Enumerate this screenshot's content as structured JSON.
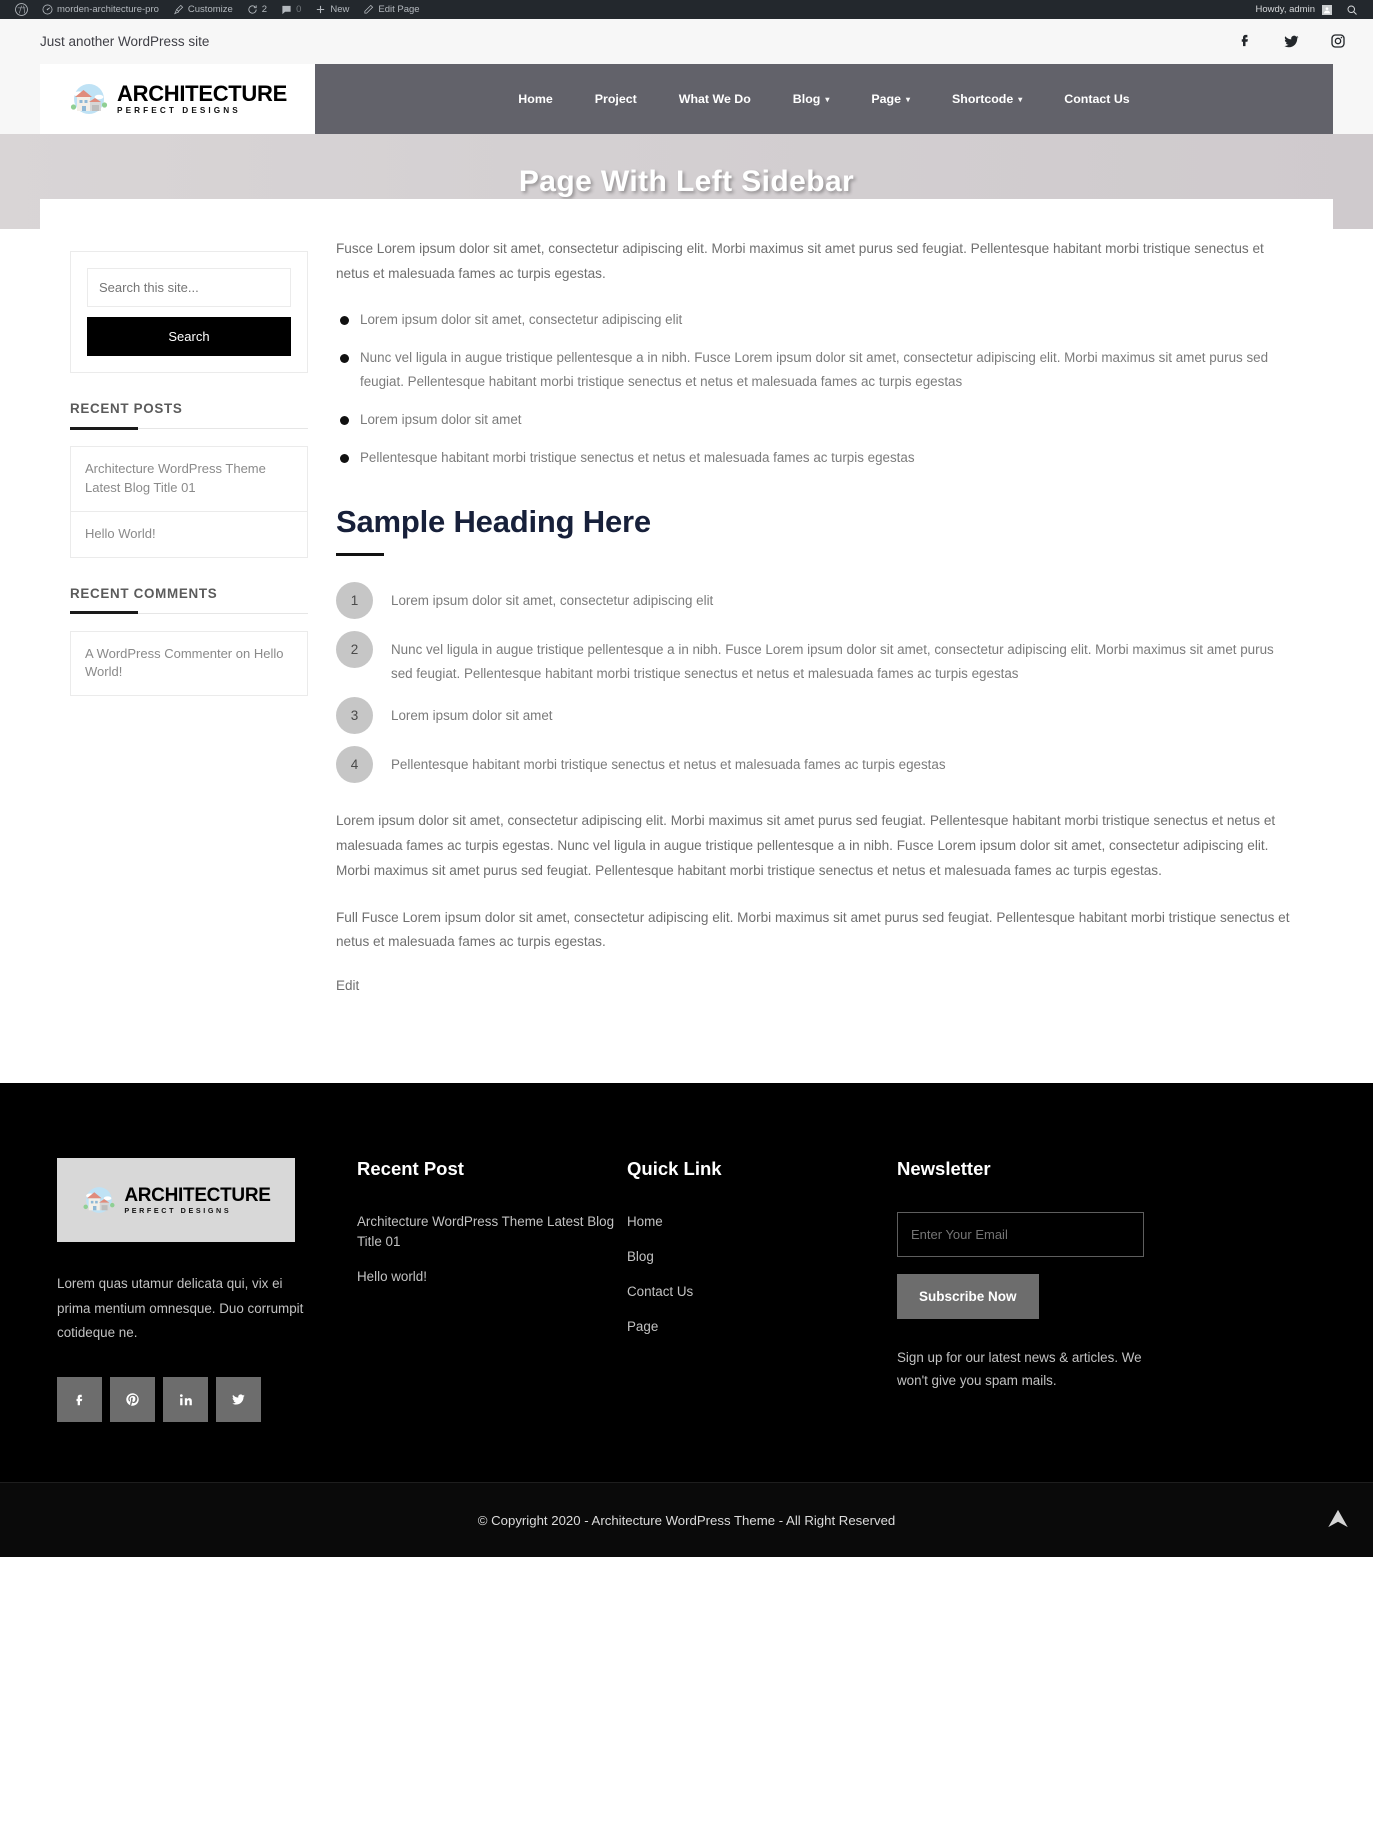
{
  "adminbar": {
    "items": [
      {
        "icon": "wordpress-logo-icon",
        "label": ""
      },
      {
        "icon": "dashboard-icon",
        "label": "morden-architecture-pro"
      },
      {
        "icon": "brush-icon",
        "label": "Customize"
      },
      {
        "icon": "revision-icon",
        "label": "2"
      },
      {
        "icon": "comment-icon",
        "label": "0"
      },
      {
        "icon": "plus-icon",
        "label": "New"
      },
      {
        "icon": "pencil-icon",
        "label": "Edit Page"
      }
    ],
    "howdy": "Howdy, admin",
    "search_icon": "search-icon"
  },
  "topbar": {
    "tagline": "Just another WordPress site",
    "social": [
      "facebook-icon",
      "twitter-icon",
      "instagram-icon"
    ]
  },
  "header": {
    "logo": {
      "line1": "ARCHITECTURE",
      "line2": "PERFECT DESIGNS"
    },
    "nav": [
      {
        "label": "Home",
        "has_caret": false
      },
      {
        "label": "Project",
        "has_caret": false
      },
      {
        "label": "What We Do",
        "has_caret": false
      },
      {
        "label": "Blog",
        "has_caret": true
      },
      {
        "label": "Page",
        "has_caret": true
      },
      {
        "label": "Shortcode",
        "has_caret": true
      },
      {
        "label": "Contact Us",
        "has_caret": false
      }
    ]
  },
  "banner": {
    "title": "Page With Left Sidebar"
  },
  "sidebar": {
    "search": {
      "placeholder": "Search this site...",
      "button": "Search"
    },
    "recent_posts": {
      "title": "RECENT POSTS",
      "items": [
        "Architecture WordPress Theme Latest Blog Title 01",
        "Hello World!"
      ]
    },
    "recent_comments": {
      "title": "RECENT COMMENTS",
      "items": [
        "A WordPress Commenter on Hello World!"
      ]
    }
  },
  "content": {
    "intro": "Fusce Lorem ipsum dolor sit amet, consectetur adipiscing elit. Morbi maximus sit amet purus sed feugiat. Pellentesque habitant morbi tristique senectus et netus et malesuada fames ac turpis egestas.",
    "bullets": [
      "Lorem ipsum dolor sit amet, consectetur adipiscing elit",
      "Nunc vel ligula in augue tristique pellentesque a in nibh. Fusce Lorem ipsum dolor sit amet, consectetur adipiscing elit. Morbi maximus sit amet purus sed feugiat. Pellentesque habitant morbi tristique senectus et netus et malesuada fames ac turpis egestas",
      "Lorem ipsum dolor sit amet",
      "Pellentesque habitant morbi tristique senectus et netus et malesuada fames ac turpis egestas"
    ],
    "heading": "Sample Heading Here",
    "numbered": [
      {
        "num": "1",
        "text": "Lorem ipsum dolor sit amet, consectetur adipiscing elit"
      },
      {
        "num": "2",
        "text": "Nunc vel ligula in augue tristique pellentesque a in nibh. Fusce Lorem ipsum dolor sit amet, consectetur adipiscing elit. Morbi maximus sit amet purus sed feugiat. Pellentesque habitant morbi tristique senectus et netus et malesuada fames ac turpis egestas"
      },
      {
        "num": "3",
        "text": "Lorem ipsum dolor sit amet"
      },
      {
        "num": "4",
        "text": "Pellentesque habitant morbi tristique senectus et netus et malesuada fames ac turpis egestas"
      }
    ],
    "para2": "Lorem ipsum dolor sit amet, consectetur adipiscing elit. Morbi maximus sit amet purus sed feugiat. Pellentesque habitant morbi tristique senectus et netus et malesuada fames ac turpis egestas. Nunc vel ligula in augue tristique pellentesque a in nibh. Fusce Lorem ipsum dolor sit amet, consectetur adipiscing elit. Morbi maximus sit amet purus sed feugiat. Pellentesque habitant morbi tristique senectus et netus et malesuada fames ac turpis egestas.",
    "para3": "Full Fusce Lorem ipsum dolor sit amet, consectetur adipiscing elit. Morbi maximus sit amet purus sed feugiat. Pellentesque habitant morbi tristique senectus et netus et malesuada fames ac turpis egestas.",
    "edit_link": "Edit"
  },
  "footer": {
    "logo": {
      "line1": "ARCHITECTURE",
      "line2": "PERFECT DESIGNS"
    },
    "description": "Lorem quas utamur delicata qui, vix ei prima mentium omnesque. Duo corrumpit cotideque ne.",
    "social": [
      "facebook-icon",
      "pinterest-icon",
      "linkedin-icon",
      "twitter-icon"
    ],
    "recent_post": {
      "title": "Recent Post",
      "items": [
        "Architecture WordPress Theme Latest Blog Title 01",
        "Hello world!"
      ]
    },
    "quick_link": {
      "title": "Quick Link",
      "items": [
        "Home",
        "Blog",
        "Contact Us",
        "Page"
      ]
    },
    "newsletter": {
      "title": "Newsletter",
      "placeholder": "Enter Your Email",
      "button": "Subscribe Now",
      "note": "Sign up for our latest news & articles. We won't give you spam mails."
    },
    "copyright": "© Copyright 2020 - Architecture WordPress Theme - All Right Reserved"
  },
  "colors": {
    "admin_bar": "#23282d",
    "nav_bg": "#62626a",
    "accent_dark": "#17203a",
    "footer_bg": "#000000"
  }
}
